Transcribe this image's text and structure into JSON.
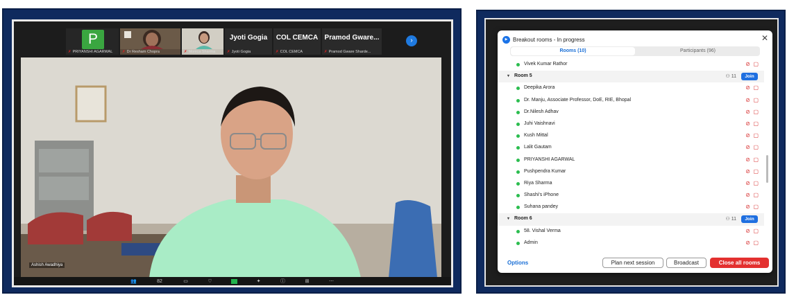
{
  "left": {
    "participants_strip": [
      {
        "type": "avatar",
        "letter": "P",
        "name": "PRIYANSHI AGARWAL"
      },
      {
        "type": "camera",
        "name": "Dr Resham Chopra"
      },
      {
        "type": "camera",
        "name": "Monica Sharma"
      },
      {
        "type": "name",
        "display": "Jyoti Gogia",
        "name": "Jyoti Gogia"
      },
      {
        "type": "name",
        "display": "COL CEMCA",
        "name": "COL CEMCA"
      },
      {
        "type": "name",
        "display": "Pramod Gware...",
        "name": "Pramod Gware Sharde..."
      }
    ],
    "speaker_name": "Ashish Awadhiya",
    "toolbar_count": "82"
  },
  "dialog": {
    "title": "Breakout rooms - In progress",
    "tabs": [
      "Rooms (10)",
      "Participants (96)"
    ],
    "rows": [
      {
        "kind": "person",
        "name": "Vivek Kumar Rathor"
      },
      {
        "kind": "room",
        "name": "Room 5",
        "count": "11",
        "join": "Join"
      },
      {
        "kind": "person",
        "name": "Deepika Arora"
      },
      {
        "kind": "person",
        "name": "Dr. Manju, Associate Professor, DoE, RIE, Bhopal"
      },
      {
        "kind": "person",
        "name": "Dr.Nilesh Adhav"
      },
      {
        "kind": "person",
        "name": "Juhi Vaishnavi"
      },
      {
        "kind": "person",
        "name": "Kush Mittal"
      },
      {
        "kind": "person",
        "name": "Lalit Gautam"
      },
      {
        "kind": "person",
        "name": "PRIYANSHI AGARWAL"
      },
      {
        "kind": "person",
        "name": "Pushpendra Kumar"
      },
      {
        "kind": "person",
        "name": "Riya Sharma"
      },
      {
        "kind": "person",
        "name": "Shashi's iPhone"
      },
      {
        "kind": "person",
        "name": "Suhana pandey"
      },
      {
        "kind": "room",
        "name": "Room 6",
        "count": "11",
        "join": "Join"
      },
      {
        "kind": "person",
        "name": "58. Vishal Verma"
      },
      {
        "kind": "person",
        "name": "Admin"
      }
    ],
    "footer": {
      "options": "Options",
      "plan": "Plan next session",
      "broadcast": "Broadcast",
      "close_all": "Close all rooms"
    }
  },
  "colors": {
    "frame": "#0f2a5e",
    "accent": "#1f6fe0",
    "danger": "#e3302f",
    "online": "#2bbd4f",
    "zoom_green": "#3aa640"
  }
}
